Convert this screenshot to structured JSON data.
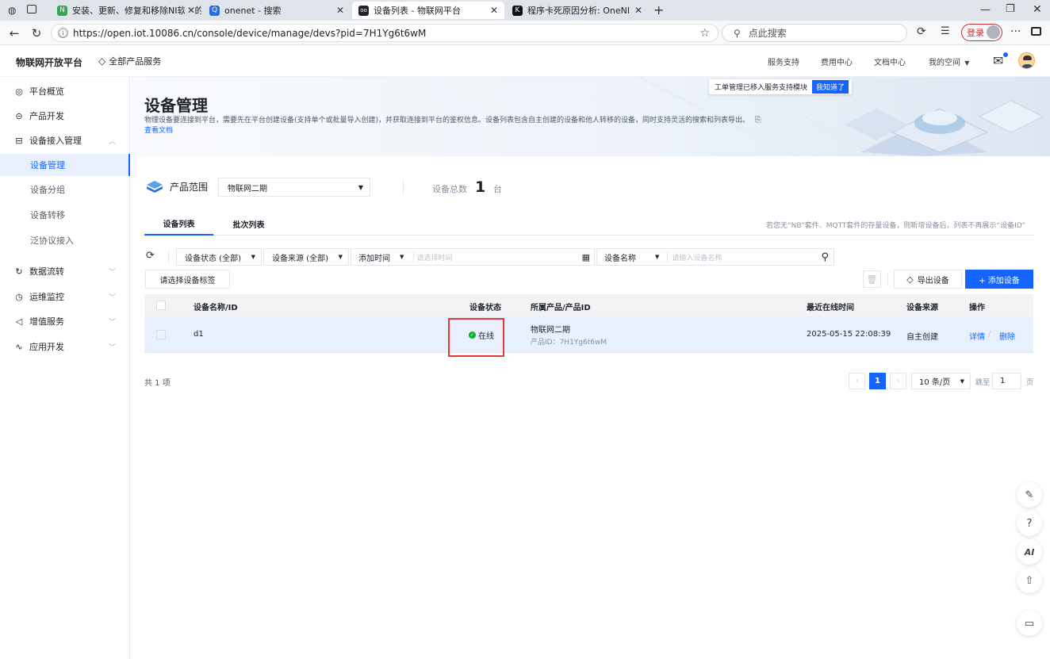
{
  "browser": {
    "tabs": [
      {
        "label": "安装、更新、修复和移除NI软件的",
        "fav_color": "#36a852",
        "fav_text": "N"
      },
      {
        "label": "onenet - 搜索",
        "fav_color": "#2b6cde",
        "fav_text": "Q"
      },
      {
        "label": "设备列表 - 物联网平台",
        "fav_color": "#1f2329",
        "fav_text": "oo"
      },
      {
        "label": "程序卡死原因分析: OneNET_Aut",
        "fav_color": "#111",
        "fav_text": "K"
      }
    ],
    "new_tab": "+",
    "url": "https://open.iot.10086.cn/console/device/manage/devs?pid=7H1Yg6t6wM",
    "search_placeholder": "点此搜索",
    "login_label": "登录"
  },
  "app_header": {
    "brand": "物联网开放平台",
    "all_products": "全部产品服务",
    "nav": [
      "服务支持",
      "费用中心",
      "文档中心",
      "我的空间"
    ]
  },
  "sidebar": {
    "items": [
      {
        "label": "平台概览",
        "icon": "◎"
      },
      {
        "label": "产品开发",
        "icon": "⊝"
      },
      {
        "label": "设备接入管理",
        "icon": "⊟"
      }
    ],
    "sub_items": [
      "设备管理",
      "设备分组",
      "设备转移",
      "泛协议接入"
    ],
    "more_items": [
      {
        "label": "数据流转",
        "icon": "↻"
      },
      {
        "label": "运维监控",
        "icon": "◷"
      },
      {
        "label": "增值服务",
        "icon": "◁"
      },
      {
        "label": "应用开发",
        "icon": "∿"
      }
    ]
  },
  "banner": {
    "title": "设备管理",
    "desc": "物理设备要连接到平台，需要先在平台创建设备(支持单个或批量导入创建)，并获取连接到平台的鉴权信息。设备列表包含自主创建的设备和他人转移的设备，同时支持灵活的搜索和列表导出。",
    "doc_link": "查看文档",
    "notice": "工单管理已移入服务支持模块",
    "notice_btn": "我知道了"
  },
  "product": {
    "label": "产品范围",
    "selected": "物联网二期",
    "count_label": "设备总数",
    "count": "1",
    "count_unit": "台"
  },
  "tabs": {
    "items": [
      "设备列表",
      "批次列表"
    ],
    "hint": "若您无“NB”套件、MQTT套件的存量设备，则新增设备后，列表不再展示“设备ID”"
  },
  "filters": {
    "status": "设备状态 (全部)",
    "source": "设备来源 (全部)",
    "time_field": "添加时间",
    "time_placeholder": "请选择时间",
    "name_field": "设备名称",
    "name_placeholder": "请输入设备名称",
    "tag_btn": "请选择设备标签",
    "export_btn": "导出设备",
    "add_btn": "+ 添加设备"
  },
  "table": {
    "headers": [
      "设备名称/ID",
      "设备状态",
      "所属产品/产品ID",
      "最近在线时间",
      "设备来源",
      "操作"
    ],
    "rows": [
      {
        "name": "d1",
        "status": "在线",
        "product": "物联网二期",
        "product_id": "产品ID：7H1Yg6t6wM",
        "last_online": "2025-05-15 22:08:39",
        "source": "自主创建",
        "action_detail": "详情",
        "action_sep": "/",
        "action_delete": "删除"
      }
    ]
  },
  "pagination": {
    "total": "共 1 项",
    "current": "1",
    "page_size": "10 条/页",
    "jump_label": "跳至",
    "jump_value": "1",
    "page_unit": "页"
  },
  "float_buttons": [
    "edit-icon",
    "help-icon",
    "ai-icon",
    "upload-icon",
    "panel-icon"
  ],
  "float_ai_label": "AI",
  "colors": {
    "accent": "#1664ff",
    "online": "#00b42a",
    "highlight": "#e53935"
  }
}
